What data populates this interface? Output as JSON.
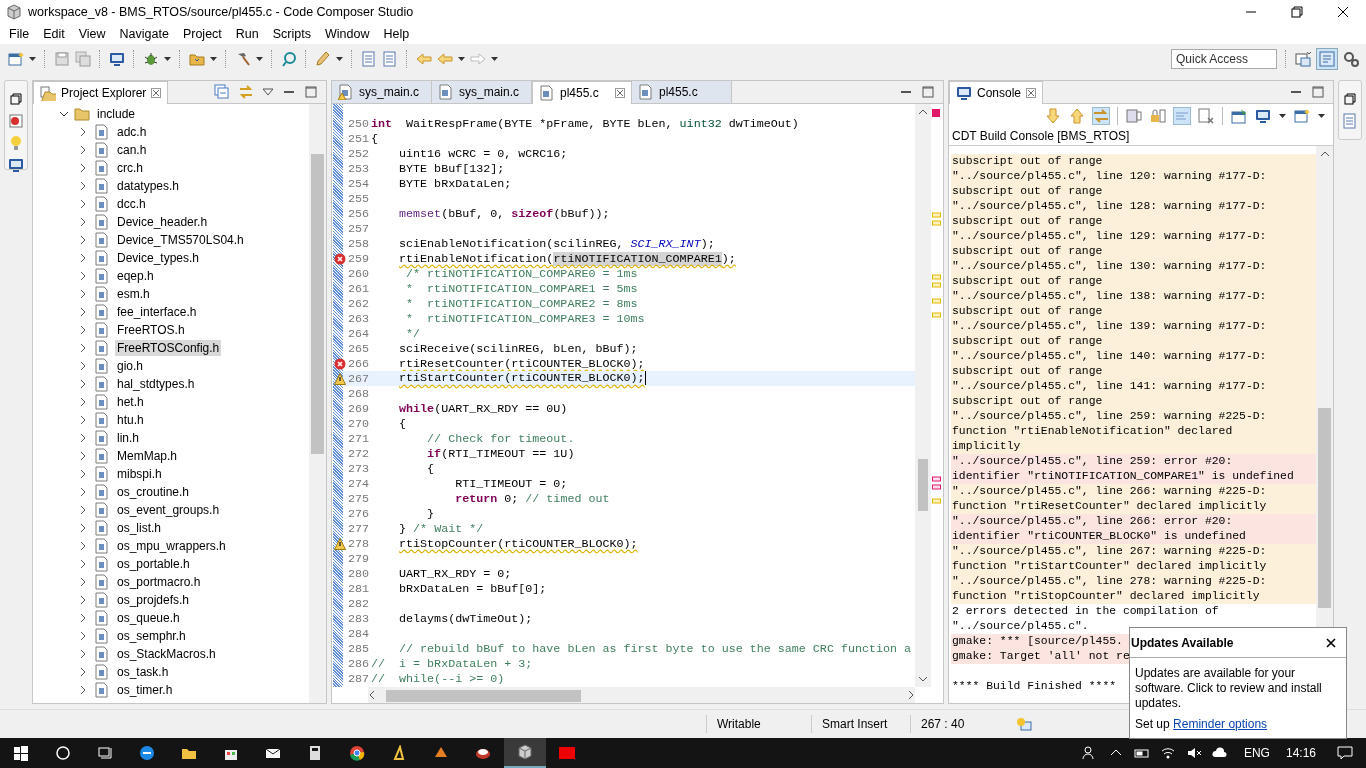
{
  "window": {
    "title": "workspace_v8 - BMS_RTOS/source/pl455.c - Code Composer Studio"
  },
  "menu": [
    "File",
    "Edit",
    "View",
    "Navigate",
    "Project",
    "Run",
    "Scripts",
    "Window",
    "Help"
  ],
  "quick_access": {
    "placeholder": "Quick Access"
  },
  "project_explorer": {
    "title": "Project Explorer",
    "tree": [
      {
        "label": "include",
        "expanded": true,
        "selected": false,
        "children": [
          {
            "label": "adc.h",
            "expanded": false,
            "selected": false
          },
          {
            "label": "can.h",
            "expanded": false,
            "selected": false
          },
          {
            "label": "crc.h",
            "expanded": false,
            "selected": false
          },
          {
            "label": "datatypes.h",
            "expanded": false,
            "selected": false
          },
          {
            "label": "dcc.h",
            "expanded": false,
            "selected": false
          },
          {
            "label": "Device_header.h",
            "expanded": false,
            "selected": false
          },
          {
            "label": "Device_TMS570LS04.h",
            "expanded": false,
            "selected": false
          },
          {
            "label": "Device_types.h",
            "expanded": false,
            "selected": false
          },
          {
            "label": "eqep.h",
            "expanded": false,
            "selected": false
          },
          {
            "label": "esm.h",
            "expanded": false,
            "selected": false
          },
          {
            "label": "fee_interface.h",
            "expanded": false,
            "selected": false
          },
          {
            "label": "FreeRTOS.h",
            "expanded": false,
            "selected": false
          },
          {
            "label": "FreeRTOSConfig.h",
            "expanded": false,
            "selected": true
          },
          {
            "label": "gio.h",
            "expanded": false,
            "selected": false
          },
          {
            "label": "hal_stdtypes.h",
            "expanded": false,
            "selected": false
          },
          {
            "label": "het.h",
            "expanded": false,
            "selected": false
          },
          {
            "label": "htu.h",
            "expanded": false,
            "selected": false
          },
          {
            "label": "lin.h",
            "expanded": false,
            "selected": false
          },
          {
            "label": "MemMap.h",
            "expanded": false,
            "selected": false
          },
          {
            "label": "mibspi.h",
            "expanded": false,
            "selected": false
          },
          {
            "label": "os_croutine.h",
            "expanded": false,
            "selected": false
          },
          {
            "label": "os_event_groups.h",
            "expanded": false,
            "selected": false
          },
          {
            "label": "os_list.h",
            "expanded": false,
            "selected": false
          },
          {
            "label": "os_mpu_wrappers.h",
            "expanded": false,
            "selected": false
          },
          {
            "label": "os_portable.h",
            "expanded": false,
            "selected": false
          },
          {
            "label": "os_portmacro.h",
            "expanded": false,
            "selected": false
          },
          {
            "label": "os_projdefs.h",
            "expanded": false,
            "selected": false
          },
          {
            "label": "os_queue.h",
            "expanded": false,
            "selected": false
          },
          {
            "label": "os_semphr.h",
            "expanded": false,
            "selected": false
          },
          {
            "label": "os_StackMacros.h",
            "expanded": false,
            "selected": false
          },
          {
            "label": "os_task.h",
            "expanded": false,
            "selected": false
          },
          {
            "label": "os_timer.h",
            "expanded": false,
            "selected": false
          }
        ]
      }
    ]
  },
  "editor": {
    "tabs": [
      {
        "label": "sys_main.c",
        "selected": false,
        "warning": true
      },
      {
        "label": "sys_main.c",
        "selected": false,
        "warning": false
      },
      {
        "label": "pl455.c",
        "selected": true,
        "warning": false
      },
      {
        "label": "pl455.c",
        "selected": false,
        "warning": false
      }
    ],
    "lines": [
      {
        "number": "250",
        "tokens": [
          {
            "text": "int",
            "kind": "keyword"
          },
          {
            "text": "  WaitRespFrame(BYTE *pFrame, BYTE bLen, ",
            "kind": "plain"
          },
          {
            "text": "uint32",
            "kind": "type"
          },
          {
            "text": " dwTimeOut)",
            "kind": "plain"
          }
        ]
      },
      {
        "number": "251",
        "tokens": [
          {
            "text": "{",
            "kind": "plain"
          }
        ]
      },
      {
        "number": "252",
        "tokens": [
          {
            "text": "    uint16 wCRC = 0, wCRC16;",
            "kind": "plain"
          }
        ]
      },
      {
        "number": "253",
        "tokens": [
          {
            "text": "    BYTE bBuf[132];",
            "kind": "plain"
          }
        ]
      },
      {
        "number": "254",
        "tokens": [
          {
            "text": "    BYTE bRxDataLen;",
            "kind": "plain"
          }
        ]
      },
      {
        "number": "255"
      },
      {
        "number": "256",
        "tokens": [
          {
            "text": "    memset",
            "kind": "macro"
          },
          {
            "text": "(bBuf, 0, ",
            "kind": "plain"
          },
          {
            "text": "sizeof",
            "kind": "keyword"
          },
          {
            "text": "(bBuf));",
            "kind": "plain"
          }
        ]
      },
      {
        "number": "257"
      },
      {
        "number": "258",
        "tokens": [
          {
            "text": "    sciEnableNotification(scilinREG, ",
            "kind": "plain"
          },
          {
            "text": "SCI_RX_INT",
            "kind": "constant"
          },
          {
            "text": ");",
            "kind": "plain"
          }
        ]
      },
      {
        "number": "259",
        "kind": "error",
        "squiggle": true,
        "tokens": [
          {
            "text": "    rtiEnableNotification(",
            "kind": "plain"
          },
          {
            "text": "rtiNOTIFICATION_COMPARE1",
            "kind": "selected"
          },
          {
            "text": ");",
            "kind": "plain"
          }
        ]
      },
      {
        "number": "260",
        "tokens": [
          {
            "text": "     /* rtiNOTIFICATION_COMPARE0 = 1ms",
            "kind": "comment"
          }
        ]
      },
      {
        "number": "261",
        "tokens": [
          {
            "text": "     *  rtiNOTIFICATION_COMPARE1 = 5ms",
            "kind": "comment"
          }
        ]
      },
      {
        "number": "262",
        "tokens": [
          {
            "text": "     *  rtiNOTIFICATION_COMPARE2 = 8ms",
            "kind": "comment"
          }
        ]
      },
      {
        "number": "263",
        "tokens": [
          {
            "text": "     *  rtiNOTIFICATION_COMPARE3 = 10ms",
            "kind": "comment"
          }
        ]
      },
      {
        "number": "264",
        "tokens": [
          {
            "text": "     */",
            "kind": "comment"
          }
        ]
      },
      {
        "number": "265",
        "tokens": [
          {
            "text": "    sciReceive(scilinREG, bLen, bBuf);",
            "kind": "plain"
          }
        ]
      },
      {
        "number": "266",
        "kind": "error",
        "squiggle": true,
        "tokens": [
          {
            "text": "    rtiResetCounter(rtiCOUNTER_BLOCK0);",
            "kind": "plain"
          }
        ]
      },
      {
        "number": "267",
        "kind": "warning",
        "squiggle": true,
        "current": true,
        "tokens": [
          {
            "text": "    rtiStartCounter(rtiCOUNTER_BLOCK0);",
            "kind": "plain"
          }
        ]
      },
      {
        "number": "268"
      },
      {
        "number": "269",
        "tokens": [
          {
            "text": "    while",
            "kind": "keyword"
          },
          {
            "text": "(UART_RX_RDY == 0U)",
            "kind": "plain"
          }
        ]
      },
      {
        "number": "270",
        "tokens": [
          {
            "text": "    {",
            "kind": "plain"
          }
        ]
      },
      {
        "number": "271",
        "tokens": [
          {
            "text": "        // Check for timeout.",
            "kind": "comment"
          }
        ]
      },
      {
        "number": "272",
        "tokens": [
          {
            "text": "        if",
            "kind": "keyword"
          },
          {
            "text": "(RTI_TIMEOUT == 1U)",
            "kind": "plain"
          }
        ]
      },
      {
        "number": "273",
        "tokens": [
          {
            "text": "        {",
            "kind": "plain"
          }
        ]
      },
      {
        "number": "274",
        "tokens": [
          {
            "text": "            RTI_TIMEOUT = 0;",
            "kind": "plain"
          }
        ]
      },
      {
        "number": "275",
        "tokens": [
          {
            "text": "            return",
            "kind": "keyword"
          },
          {
            "text": " 0; ",
            "kind": "plain"
          },
          {
            "text": "// timed out",
            "kind": "comment"
          }
        ]
      },
      {
        "number": "276",
        "tokens": [
          {
            "text": "        }",
            "kind": "plain"
          }
        ]
      },
      {
        "number": "277",
        "tokens": [
          {
            "text": "    } ",
            "kind": "plain"
          },
          {
            "text": "/* Wait */",
            "kind": "comment"
          }
        ]
      },
      {
        "number": "278",
        "kind": "warning",
        "squiggle": true,
        "tokens": [
          {
            "text": "    rtiStopCounter(rtiCOUNTER_BLOCK0);",
            "kind": "plain"
          }
        ]
      },
      {
        "number": "279"
      },
      {
        "number": "280",
        "tokens": [
          {
            "text": "    UART_RX_RDY = 0;",
            "kind": "plain"
          }
        ]
      },
      {
        "number": "281",
        "tokens": [
          {
            "text": "    bRxDataLen = bBuf[0];",
            "kind": "plain"
          }
        ]
      },
      {
        "number": "282"
      },
      {
        "number": "283",
        "tokens": [
          {
            "text": "    delayms(dwTimeOut);",
            "kind": "plain"
          }
        ]
      },
      {
        "number": "284"
      },
      {
        "number": "285",
        "tokens": [
          {
            "text": "    // rebuild bBuf to have bLen as first byte to use the same CRC function a",
            "kind": "comment"
          }
        ]
      },
      {
        "number": "286",
        "tokens": [
          {
            "text": "//  i = bRxDataLen + 3;",
            "kind": "comment"
          }
        ]
      },
      {
        "number": "287",
        "tokens": [
          {
            "text": "//  while(--i >= 0)",
            "kind": "comment"
          }
        ]
      }
    ]
  },
  "console": {
    "title": "Console",
    "subtitle": "CDT Build Console [BMS_RTOS]",
    "entries": [
      {
        "kind": "warning",
        "lines": [
          "subscript out of range"
        ]
      },
      {
        "kind": "warning",
        "lines": [
          "\"../source/pl455.c\", line 120: warning #177-D:",
          "subscript out of range"
        ]
      },
      {
        "kind": "warning",
        "lines": [
          "\"../source/pl455.c\", line 128: warning #177-D:",
          "subscript out of range"
        ]
      },
      {
        "kind": "warning",
        "lines": [
          "\"../source/pl455.c\", line 129: warning #177-D:",
          "subscript out of range"
        ]
      },
      {
        "kind": "warning",
        "lines": [
          "\"../source/pl455.c\", line 130: warning #177-D:",
          "subscript out of range"
        ]
      },
      {
        "kind": "warning",
        "lines": [
          "\"../source/pl455.c\", line 138: warning #177-D:",
          "subscript out of range"
        ]
      },
      {
        "kind": "warning",
        "lines": [
          "\"../source/pl455.c\", line 139: warning #177-D:",
          "subscript out of range"
        ]
      },
      {
        "kind": "warning",
        "lines": [
          "\"../source/pl455.c\", line 140: warning #177-D:",
          "subscript out of range"
        ]
      },
      {
        "kind": "warning",
        "lines": [
          "\"../source/pl455.c\", line 141: warning #177-D:",
          "subscript out of range"
        ]
      },
      {
        "kind": "warning",
        "lines": [
          "\"../source/pl455.c\", line 259: warning #225-D:",
          "function \"rtiEnableNotification\" declared",
          "implicitly"
        ]
      },
      {
        "kind": "error",
        "lines": [
          "\"../source/pl455.c\", line 259: error #20:",
          "identifier \"rtiNOTIFICATION_COMPARE1\" is undefined"
        ]
      },
      {
        "kind": "warning",
        "lines": [
          "\"../source/pl455.c\", line 266: warning #225-D:",
          "function \"rtiResetCounter\" declared implicitly"
        ]
      },
      {
        "kind": "error",
        "lines": [
          "\"../source/pl455.c\", line 266: error #20:",
          "identifier \"rtiCOUNTER_BLOCK0\" is undefined"
        ]
      },
      {
        "kind": "warning",
        "lines": [
          "\"../source/pl455.c\", line 267: warning #225-D:",
          "function \"rtiStartCounter\" declared implicitly"
        ]
      },
      {
        "kind": "warning",
        "lines": [
          "\"../source/pl455.c\", line 278: warning #225-D:",
          "function \"rtiStopCounter\" declared implicitly"
        ]
      },
      {
        "kind": "info",
        "lines": [
          "2 errors detected in the compilation of",
          "\"../source/pl455.c\"."
        ]
      },
      {
        "kind": "error",
        "lines": [
          "gmake: *** [source/pl455.",
          "gmake: Target 'all' not re"
        ]
      },
      {
        "kind": "finish",
        "lines": [
          "**** Build Finished ****"
        ]
      }
    ]
  },
  "status_bar": [
    "Writable",
    "Smart Insert",
    "267 : 40"
  ],
  "popup": {
    "title": "Updates Available",
    "message": "Updates are available for your software. Click to review and install updates.",
    "setup": "Set up",
    "link": "Reminder options"
  },
  "taskbar": {
    "language": "ENG",
    "time": "14:16"
  }
}
